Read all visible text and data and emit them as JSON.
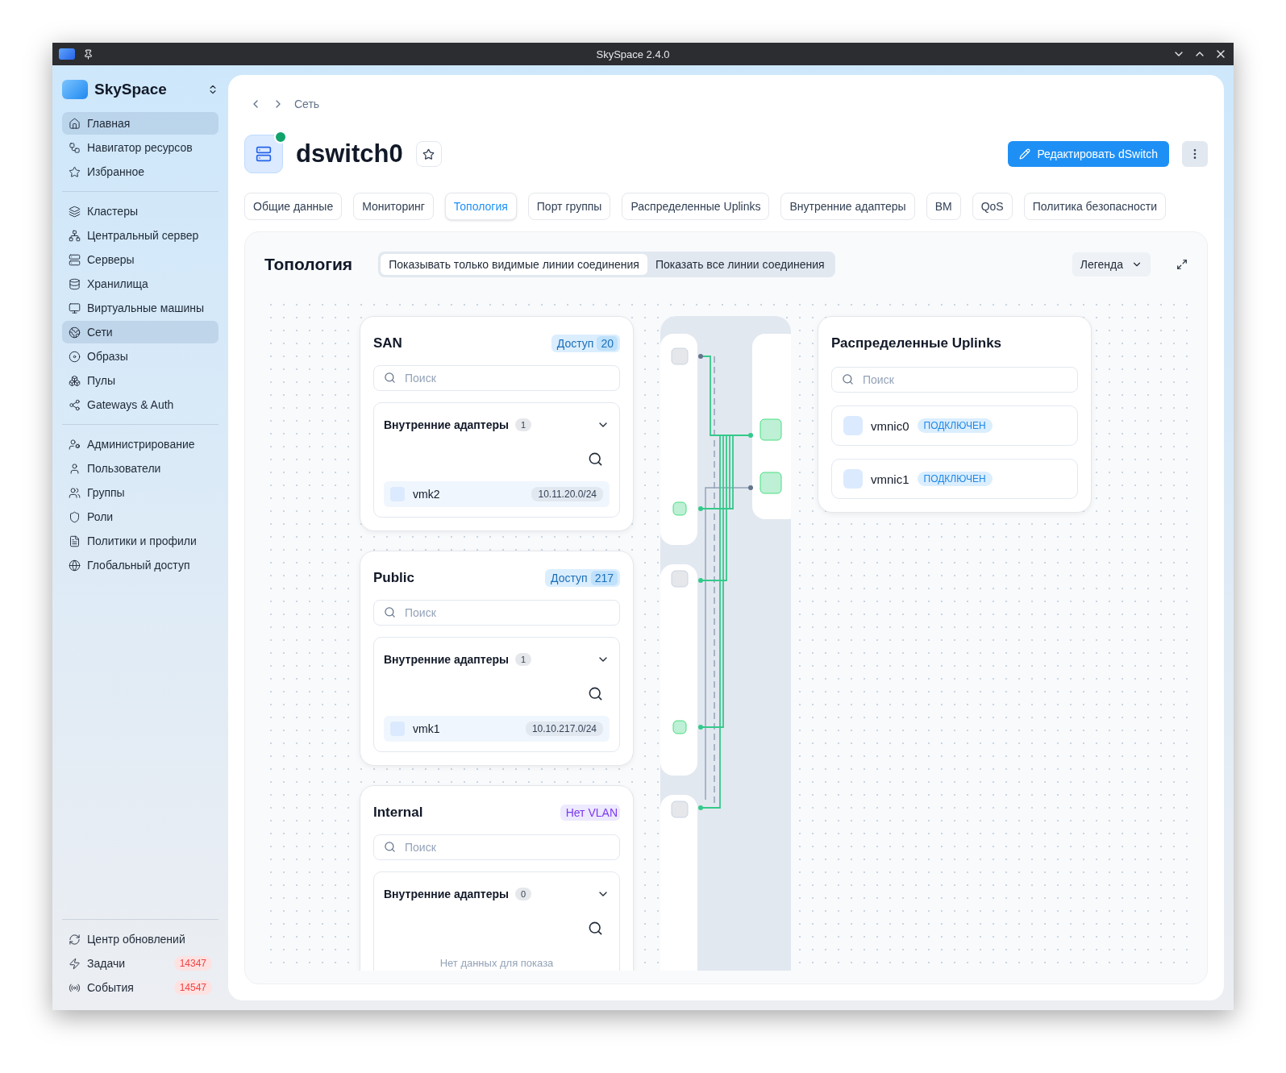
{
  "window": {
    "title": "SkySpace 2.4.0"
  },
  "sidebar": {
    "brand": "SkySpace",
    "groups": [
      [
        {
          "label": "Главная",
          "selected": true
        },
        {
          "label": "Навигатор ресурсов",
          "selected": false
        },
        {
          "label": "Избранное",
          "selected": false
        }
      ],
      [
        {
          "label": "Кластеры",
          "selected": false
        },
        {
          "label": "Центральный сервер",
          "selected": false
        },
        {
          "label": "Серверы",
          "selected": false
        },
        {
          "label": "Хранилища",
          "selected": false
        },
        {
          "label": "Виртуальные машины",
          "selected": false
        },
        {
          "label": "Сети",
          "selected": true
        },
        {
          "label": "Образы",
          "selected": false
        },
        {
          "label": "Пулы",
          "selected": false
        },
        {
          "label": "Gateways & Auth",
          "selected": false
        }
      ],
      [
        {
          "label": "Администрирование",
          "selected": false
        },
        {
          "label": "Пользователи",
          "selected": false
        },
        {
          "label": "Группы",
          "selected": false
        },
        {
          "label": "Роли",
          "selected": false
        },
        {
          "label": "Политики и профили",
          "selected": false
        },
        {
          "label": "Глобальный доступ",
          "selected": false
        }
      ]
    ],
    "bottom_items": [
      {
        "label": "Центр обновлений"
      },
      {
        "label": "Задачи",
        "count": "14347"
      },
      {
        "label": "События",
        "count": "14547"
      }
    ]
  },
  "breadcrumb": [
    "Сеть"
  ],
  "header": {
    "title": "dswitch0",
    "online": true,
    "edit_button": "Редактировать dSwitch"
  },
  "tabs": [
    {
      "label": "Общие данные",
      "selected": false
    },
    {
      "label": "Мониторинг",
      "selected": false
    },
    {
      "label": "Топология",
      "selected": true
    },
    {
      "label": "Порт группы",
      "selected": false
    },
    {
      "label": "Распределенные Uplinks",
      "selected": false
    },
    {
      "label": "Внутренние адаптеры",
      "selected": false
    },
    {
      "label": "ВМ",
      "selected": false
    },
    {
      "label": "QoS",
      "selected": false
    },
    {
      "label": "Политика безопасности",
      "selected": false
    }
  ],
  "topology": {
    "title": "Топология",
    "toggle": [
      {
        "label": "Показывать только видимые линии соединения",
        "selected": true
      },
      {
        "label": "Показать все линии соединения",
        "selected": false
      }
    ],
    "legend": "Легенда",
    "groups": [
      {
        "name": "SAN",
        "vlan": {
          "kind": "access",
          "label": "Доступ",
          "id": "20"
        },
        "placeholder": "Поиск",
        "section": "Внутренние адаптеры",
        "count": "1",
        "expanded": true,
        "adapters": [
          {
            "name": "vmk2",
            "subnet": "10.11.20.0/24"
          }
        ]
      },
      {
        "name": "Public",
        "vlan": {
          "kind": "access",
          "label": "Доступ",
          "id": "217"
        },
        "placeholder": "Поиск",
        "section": "Внутренние адаптеры",
        "count": "1",
        "expanded": true,
        "adapters": [
          {
            "name": "vmk1",
            "subnet": "10.10.217.0/24"
          }
        ]
      },
      {
        "name": "Internal",
        "vlan": {
          "kind": "none",
          "label": "Нет VLAN"
        },
        "placeholder": "Поиск",
        "section": "Внутренние адаптеры",
        "count": "0",
        "expanded": true,
        "empty": "Нет данных для показа"
      }
    ],
    "uplinks": {
      "title": "Распределенные Uplinks",
      "placeholder": "Поиск",
      "items": [
        {
          "name": "vmnic0",
          "status": "ПОДКЛЮЧЕН"
        },
        {
          "name": "vmnic1",
          "status": "ПОДКЛЮЧЕН"
        }
      ]
    }
  }
}
